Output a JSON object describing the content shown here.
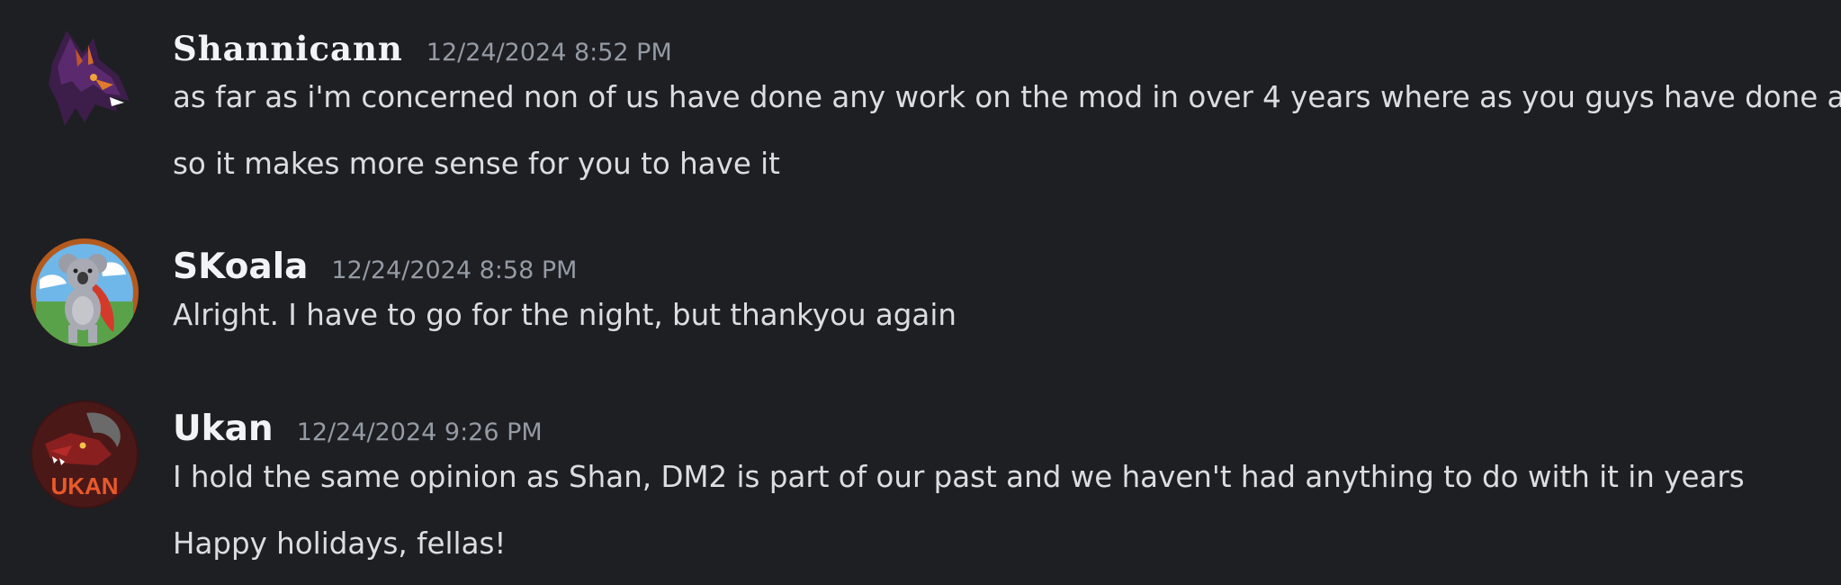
{
  "messages": [
    {
      "username": "Shannicann",
      "timestamp": "12/24/2024 8:52 PM",
      "avatar_icon": "dragon-avatar-icon",
      "lines": [
        "as far as i'm concerned non of us have done any work on the mod in over 4 years where as you guys have done a lot",
        "so it makes more sense for you to have it"
      ]
    },
    {
      "username": "SKoala",
      "timestamp": "12/24/2024 8:58 PM",
      "avatar_icon": "koala-avatar-icon",
      "lines": [
        "Alright. I have to go for the night, but thankyou again"
      ]
    },
    {
      "username": "Ukan",
      "timestamp": "12/24/2024 9:26 PM",
      "avatar_icon": "ukan-avatar-icon",
      "avatar_text": "UKAN",
      "lines": [
        "I hold the same opinion as Shan, DM2 is part of our past and we haven't had anything to do with it in years",
        "Happy holidays, fellas!"
      ]
    }
  ],
  "colors": {
    "background": "#1e1f23",
    "username": "#f2f3f5",
    "timestamp": "#949ba4",
    "message_text": "#dbdee1"
  }
}
